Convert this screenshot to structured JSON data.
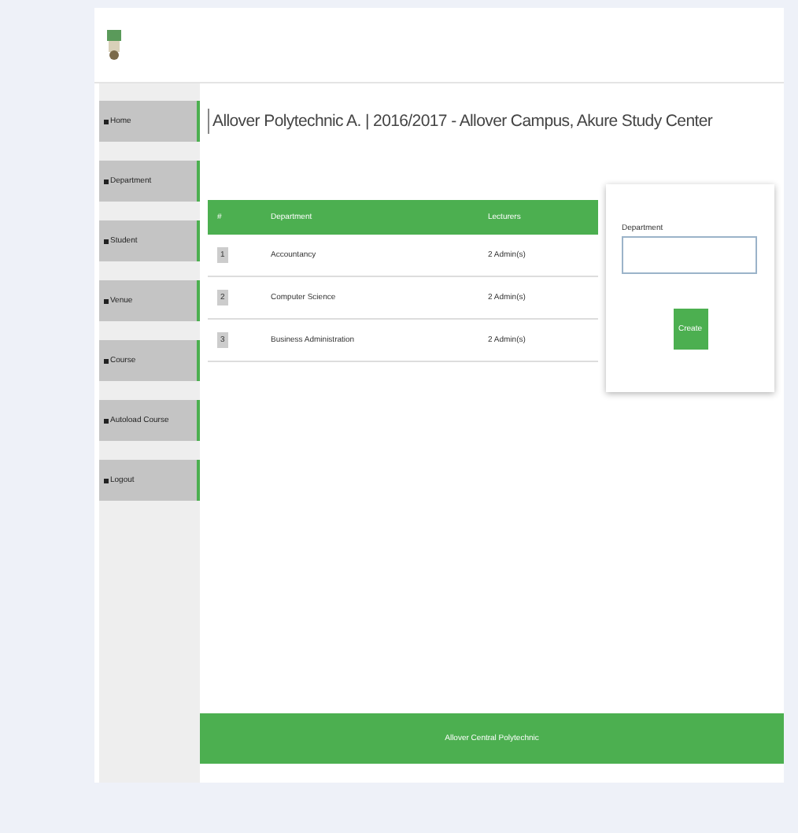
{
  "sidebar": {
    "items": [
      {
        "label": "Home"
      },
      {
        "label": "Department"
      },
      {
        "label": "Student"
      },
      {
        "label": "Venue"
      },
      {
        "label": "Course"
      },
      {
        "label": "Autoload Course"
      },
      {
        "label": "Logout"
      }
    ]
  },
  "title": "Allover Polytechnic A. | 2016/2017 - Allover Campus, Akure Study Center",
  "table": {
    "columns": [
      "#",
      "Department",
      "Lecturers"
    ],
    "rows": [
      {
        "index": "1",
        "department": "Accountancy",
        "lecturers": "2 Admin(s)"
      },
      {
        "index": "2",
        "department": "Computer Science",
        "lecturers": "2 Admin(s)"
      },
      {
        "index": "3",
        "department": "Business Administration",
        "lecturers": "2 Admin(s)"
      }
    ]
  },
  "form": {
    "label": "Department",
    "button": "Create"
  },
  "footer": "Allover Central Polytechnic"
}
